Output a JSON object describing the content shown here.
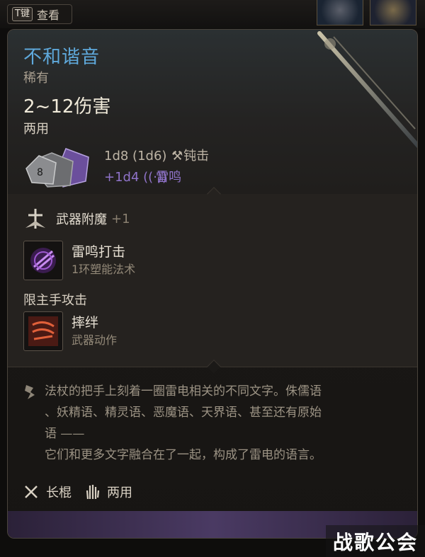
{
  "topbar": {
    "key_label": "T键",
    "view_label": "查看"
  },
  "item": {
    "name": "不和谐音",
    "rarity": "稀有",
    "damage": "2~12伤害",
    "handedness": "两用",
    "dice_main": "1d8 (1d6)",
    "damage_type": "钝击",
    "dice_bonus": "+1d4",
    "bonus_type": "雷鸣"
  },
  "enchant": {
    "label": "武器附魔",
    "value": "+1"
  },
  "spells": [
    {
      "name": "雷鸣打击",
      "sub": "1环塑能法术",
      "icon": "thunder-strike-icon"
    },
    {
      "name": "摔绊",
      "sub": "武器动作",
      "icon": "topple-icon"
    }
  ],
  "mainhand_label": "限主手攻击",
  "lore": {
    "line1": "法杖的把手上刻着一圈雷电相关的不同文字。侏儒语",
    "line2": "、妖精语、精灵语、恶魔语、天界语、甚至还有原始",
    "line3": "语 ——",
    "line4": "它们和更多文字融合在了一起，构成了雷电的语言。"
  },
  "footer": {
    "weapon_type": "长棍",
    "hands": "两用"
  },
  "watermark": "战歌公会",
  "colors": {
    "title": "#5fa9dc",
    "bonus": "#8f73c9",
    "panel": "#1c1a18"
  }
}
